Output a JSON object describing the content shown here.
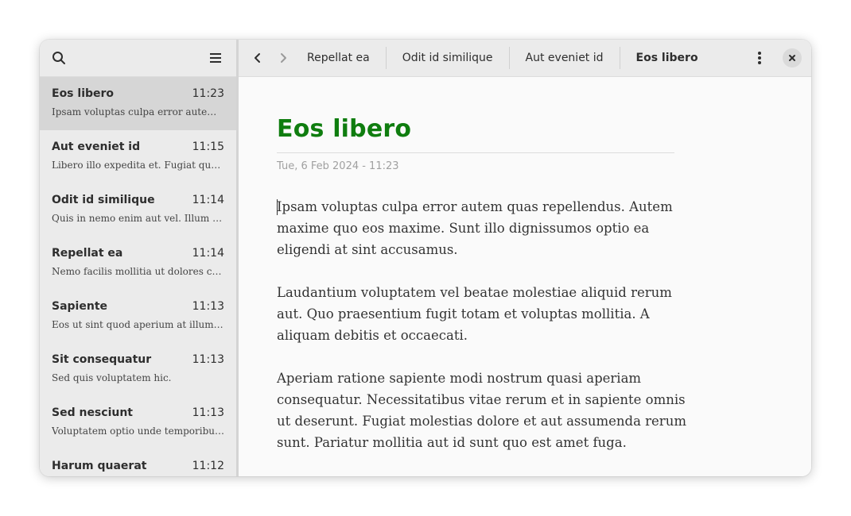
{
  "sidebar": {
    "search_icon": "search-icon",
    "menu_icon": "hamburger-icon",
    "notes": [
      {
        "title": "Eos libero",
        "time": "11:23",
        "preview": "Ipsam voluptas culpa error autem quas repellendus.",
        "selected": true
      },
      {
        "title": "Aut eveniet id",
        "time": "11:15",
        "preview": "Libero illo expedita et. Fugiat quos.",
        "selected": false
      },
      {
        "title": "Odit id similique",
        "time": "11:14",
        "preview": "Quis in nemo enim aut vel. Illum est.",
        "selected": false
      },
      {
        "title": "Repellat ea",
        "time": "11:14",
        "preview": "Nemo facilis mollitia ut dolores commodi.",
        "selected": false
      },
      {
        "title": "Sapiente",
        "time": "11:13",
        "preview": "Eos ut sint quod aperium at illum est.",
        "selected": false
      },
      {
        "title": "Sit consequatur",
        "time": "11:13",
        "preview": "Sed quis voluptatem hic.",
        "selected": false
      },
      {
        "title": "Sed nesciunt",
        "time": "11:13",
        "preview": "Voluptatem optio unde temporibus eum.",
        "selected": false
      },
      {
        "title": "Harum quaerat",
        "time": "11:12",
        "preview": "",
        "selected": false
      }
    ]
  },
  "topbar": {
    "tabs": [
      {
        "label": "Repellat ea",
        "active": false
      },
      {
        "label": "Odit id similique",
        "active": false
      },
      {
        "label": "Aut eveniet id",
        "active": false
      },
      {
        "label": "Eos libero",
        "active": true
      }
    ]
  },
  "document": {
    "title": "Eos libero",
    "date": "Tue, 6 Feb 2024 - 11:23",
    "paragraphs": [
      "Ipsam voluptas culpa error autem quas repellendus. Autem maxime quo eos maxime. Sunt illo dignissumos optio ea eligendi at sint accusamus.",
      "Laudantium voluptatem vel beatae molestiae aliquid rerum aut. Quo praesentium fugit totam et voluptas mollitia. A aliquam debitis et occaecati.",
      "Aperiam ratione sapiente modi nostrum quasi aperiam consequatur. Necessitatibus vitae rerum et in sapiente omnis ut deserunt. Fugiat molestias dolore et aut assumenda rerum sunt. Pariatur mollitia aut id sunt quo est amet fuga."
    ]
  },
  "colors": {
    "accent_title": "#0f7d0f"
  }
}
